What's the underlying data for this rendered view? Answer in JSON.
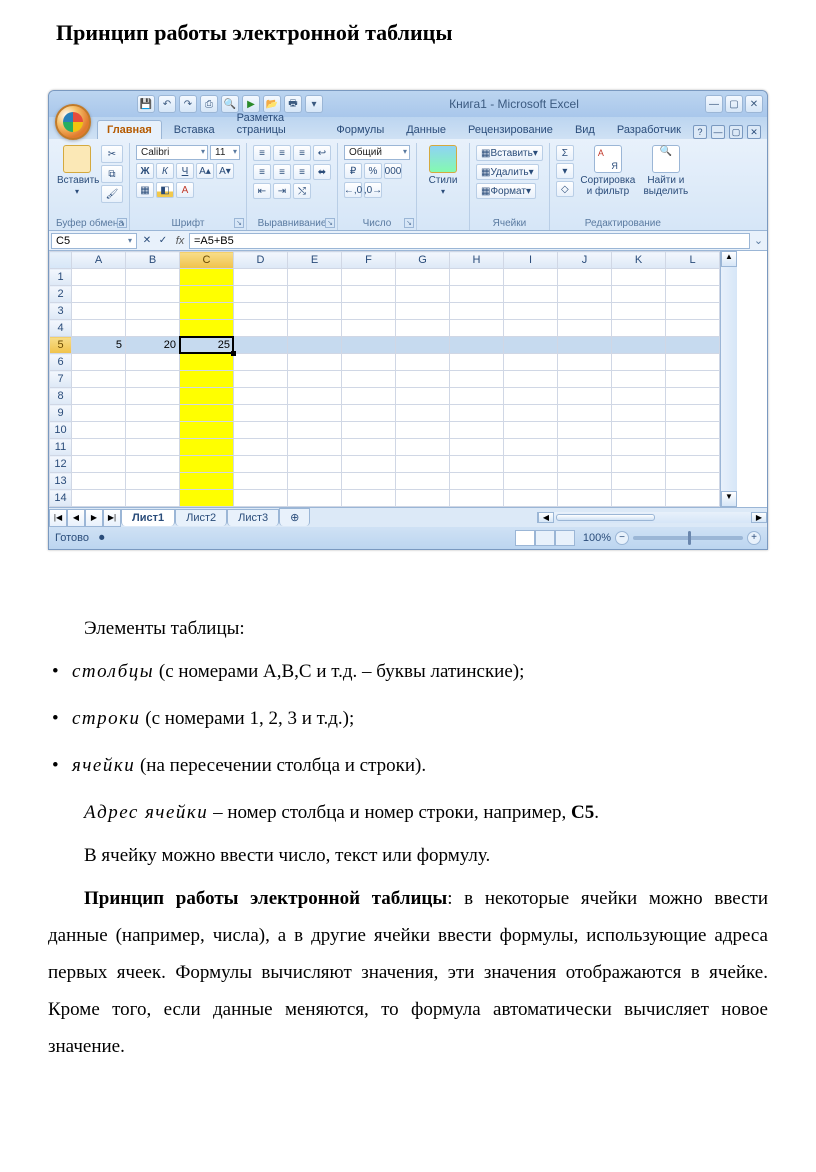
{
  "document": {
    "title": "Принцип работы электронной таблицы",
    "elements_heading": "Элементы таблицы:",
    "bullets": {
      "cols_em": "столбцы",
      "cols_rest": " (с номерами A,B,C и т.д. – буквы латинские);",
      "rows_em": "строки",
      "rows_rest": " (с номерами 1, 2, 3 и т.д.);",
      "cells_em": "ячейки",
      "cells_rest": " (на пересечении столбца и строки)."
    },
    "addr_em": "Адрес ячейки",
    "addr_rest_1": " – номер столбца и номер строки, например, ",
    "addr_bold": "С5",
    "addr_rest_2": ".",
    "p_intro": "В ячейку можно ввести число, текст или формулу.",
    "principle_bold": "Принцип работы электронной таблицы",
    "principle_rest": ": в некоторые ячейки можно ввести данные (например, числа), а в другие ячейки ввести формулы, использующие адреса первых ячеек. Формулы вычисляют значения, эти значения отображаются в ячейке. Кроме того, если данные меняются, то формула автоматически вычисляет новое значение."
  },
  "excel": {
    "window_title": "Книга1 - Microsoft Excel",
    "tabs": [
      "Главная",
      "Вставка",
      "Разметка страницы",
      "Формулы",
      "Данные",
      "Рецензирование",
      "Вид",
      "Разработчик"
    ],
    "active_tab": 0,
    "qat_icons": [
      "save-icon",
      "undo-icon",
      "redo-icon",
      "print-icon",
      "preview-icon",
      "run-icon",
      "open-icon",
      "quickprint-icon",
      "more-icon"
    ],
    "groups": {
      "clipboard": {
        "label": "Буфер обмена",
        "paste": "Вставить"
      },
      "font": {
        "label": "Шрифт",
        "name": "Calibri",
        "size": "11",
        "bold": "Ж",
        "italic": "К",
        "underline": "Ч"
      },
      "align": {
        "label": "Выравнивание"
      },
      "number": {
        "label": "Число",
        "format": "Общий",
        "percent": "%",
        "thousands": "000",
        "dec_inc": ",0",
        "dec_dec": ",00"
      },
      "styles": {
        "label": "",
        "btn": "Стили"
      },
      "cells": {
        "label": "Ячейки",
        "insert": "Вставить",
        "delete": "Удалить",
        "format": "Формат"
      },
      "editing": {
        "label": "Редактирование",
        "sigma": "Σ",
        "fill": "▾",
        "clear": "◇",
        "sort": "Сортировка и фильтр",
        "find": "Найти и выделить"
      }
    },
    "namebox": "C5",
    "formula": "=A5+B5",
    "columns": [
      "A",
      "B",
      "C",
      "D",
      "E",
      "F",
      "G",
      "H",
      "I",
      "J",
      "K",
      "L"
    ],
    "rows": 14,
    "highlight_col": 2,
    "highlight_row": 5,
    "cells": {
      "A5": "5",
      "B5": "20",
      "C5": "25"
    },
    "sheets": [
      "Лист1",
      "Лист2",
      "Лист3"
    ],
    "active_sheet": 0,
    "status": "Готово",
    "zoom": "100%"
  }
}
